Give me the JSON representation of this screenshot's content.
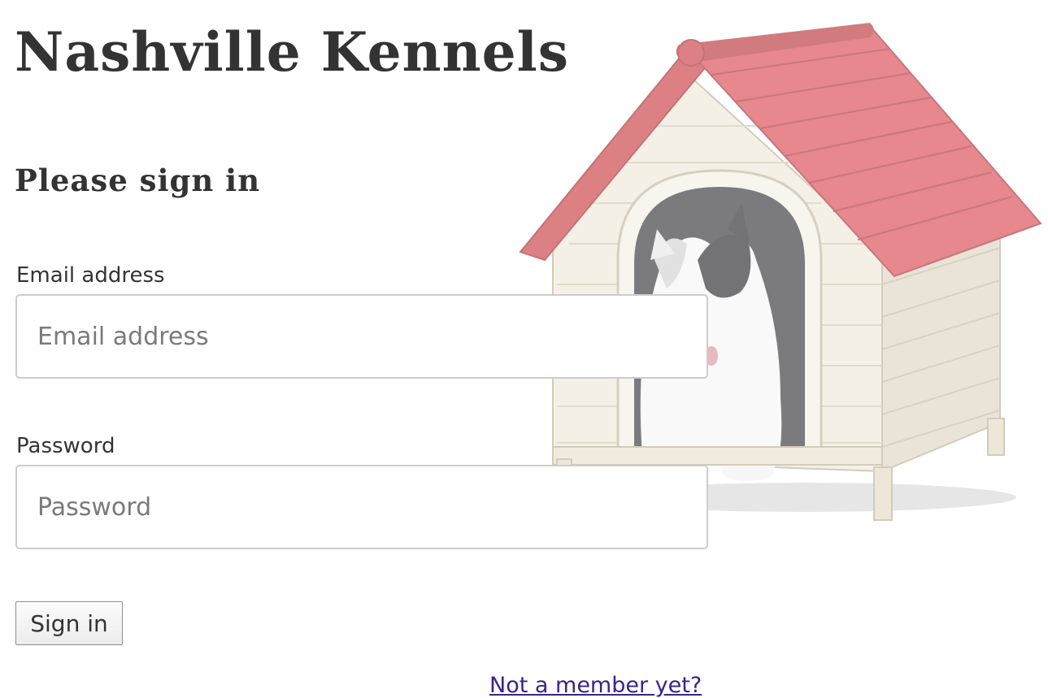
{
  "header": {
    "title": "Nashville Kennels"
  },
  "illustration": {
    "icon": "doghouse-with-dog-image",
    "roof_color": "#d9262e",
    "wall_color": "#efe8d8"
  },
  "login_form": {
    "heading": "Please sign in",
    "email": {
      "label": "Email address",
      "placeholder": "Email address",
      "value": ""
    },
    "password": {
      "label": "Password",
      "placeholder": "Password",
      "value": ""
    },
    "submit_label": "Sign in"
  },
  "footer": {
    "register_link": "Not a member yet?",
    "link_color": "#3c2385"
  }
}
